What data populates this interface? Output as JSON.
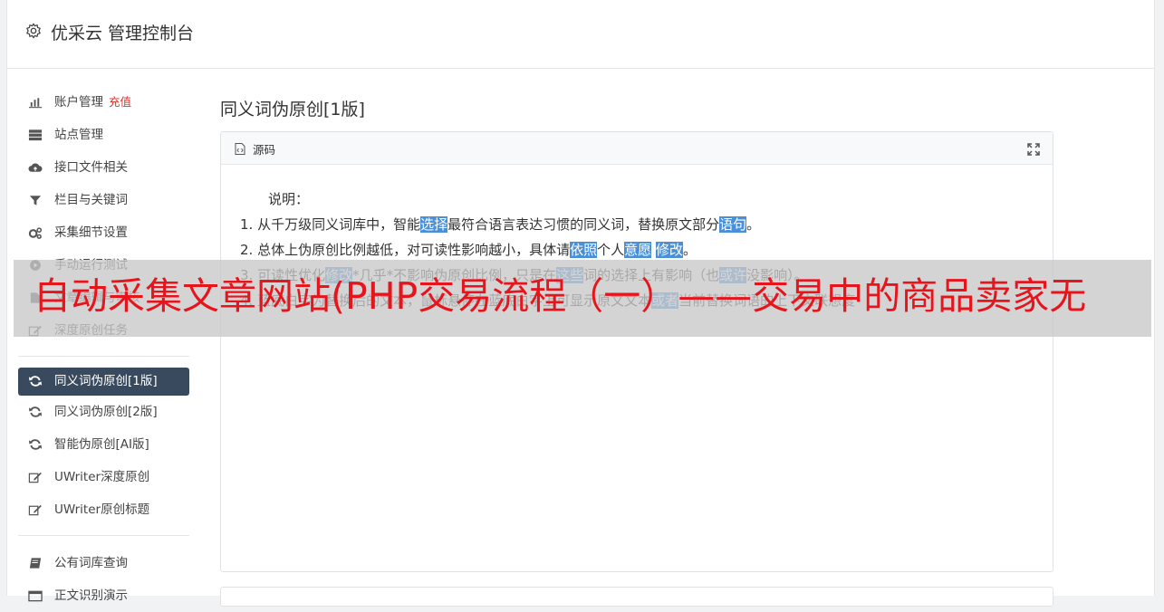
{
  "app": {
    "title": "优采云 管理控制台"
  },
  "sidebar": {
    "group1": [
      {
        "label": "账户管理",
        "badge": "充值",
        "icon": "bar-chart-icon"
      },
      {
        "label": "站点管理",
        "icon": "server-icon"
      },
      {
        "label": "接口文件相关",
        "icon": "cloud-upload-icon"
      },
      {
        "label": "栏目与关键词",
        "icon": "filter-icon"
      },
      {
        "label": "采集细节设置",
        "icon": "gears-icon"
      },
      {
        "label": "手动运行测试",
        "icon": "play-circle-icon"
      },
      {
        "label": "文章编辑与审核",
        "icon": "file-icon"
      },
      {
        "label": "深度原创任务",
        "icon": "edit-icon"
      }
    ],
    "group2": [
      {
        "label": "同义词伪原创[1版]",
        "icon": "refresh-icon",
        "active": true
      },
      {
        "label": "同义词伪原创[2版]",
        "icon": "refresh-icon"
      },
      {
        "label": "智能伪原创[AI版]",
        "icon": "refresh-icon"
      },
      {
        "label": "UWriter深度原创",
        "icon": "edit-icon"
      },
      {
        "label": "UWriter原创标题",
        "icon": "edit-icon"
      }
    ],
    "group3": [
      {
        "label": "公有词库查询",
        "icon": "book-icon"
      },
      {
        "label": "正文识别演示",
        "icon": "window-icon"
      }
    ]
  },
  "main": {
    "title": "同义词伪原创[1版]",
    "panel": {
      "header": "源码",
      "intro": "说明：",
      "lines": [
        [
          {
            "t": "1. 从千万级同义词库中，智能"
          },
          {
            "t": "选择",
            "hl": true
          },
          {
            "t": "最符合语言表达习惯的同义词，替换原文部分"
          },
          {
            "t": "语句",
            "hl": true
          },
          {
            "t": "。"
          }
        ],
        [
          {
            "t": "2. 总体上伪原创比例越低，对可读性影响越小，具体请"
          },
          {
            "t": "依照",
            "hl": true
          },
          {
            "t": "个人"
          },
          {
            "t": "意愿",
            "hl": true
          },
          {
            "t": " "
          },
          {
            "t": "修改",
            "hl": true
          },
          {
            "t": "。"
          }
        ],
        [
          {
            "t": "3. 可读性优化"
          },
          {
            "t": "修改",
            "hl": true
          },
          {
            "t": "*几乎*不影响伪原创比例，只是在"
          },
          {
            "t": "这些",
            "hl": true
          },
          {
            "t": "词的选择上有影响（也"
          },
          {
            "t": "或许",
            "hl": true
          },
          {
            "t": "没影响）。"
          }
        ],
        [
          {
            "t": "4. 蓝底白字为替换后的文本，鼠标悬停在蓝底白字上可显示原文文本"
          },
          {
            "t": "或者",
            "hl": true
          },
          {
            "t": "当前替换词语的上下文联想度"
          }
        ]
      ]
    }
  },
  "overlay": {
    "text": "自动采集文章网站(PHP交易流程（一）——交易中的商品卖家无"
  },
  "colors": {
    "accent": "#3a4a5e",
    "highlight": "#4a90d9",
    "overlay_text": "#e8141c",
    "badge": "#d9332b"
  }
}
